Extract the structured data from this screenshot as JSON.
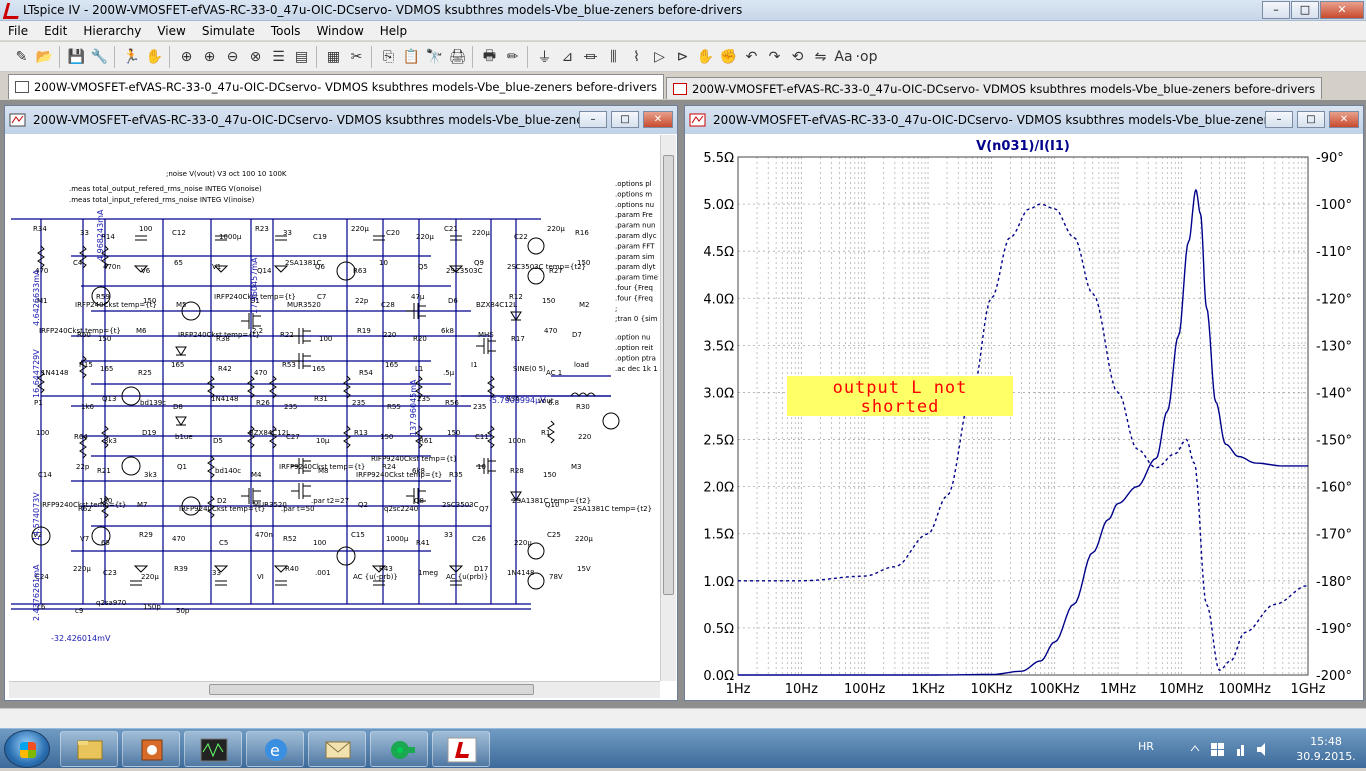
{
  "window": {
    "title": "LTspice IV - 200W-VMOSFET-efVAS-RC-33-0_47u-OIC-DCservo- VDMOS ksubthres models-Vbe_blue-zeners before-drivers",
    "minimize": "–",
    "maximize": "□",
    "close": "✕"
  },
  "menu": [
    "File",
    "Edit",
    "Hierarchy",
    "View",
    "Simulate",
    "Tools",
    "Window",
    "Help"
  ],
  "toolbar_icons": [
    "new-schematic-icon",
    "open-icon",
    "save-icon",
    "control-panel-icon",
    "run-icon",
    "halt-icon",
    "zoom-in-icon",
    "zoom-pan-icon",
    "zoom-out-icon",
    "zoom-cancel-icon",
    "draw-wire-icon",
    "view-netlist-icon",
    "cascade-icon",
    "tile-icon",
    "cut-icon",
    "copy-icon",
    "paste-icon",
    "find-icon",
    "print-setup-icon",
    "print-icon",
    "pencil-icon",
    "ground-icon",
    "label-net-icon",
    "resistor-icon",
    "capacitor-icon",
    "inductor-icon",
    "diode-icon",
    "component-icon",
    "move-icon",
    "drag-icon",
    "undo-icon",
    "redo-icon",
    "rotate-icon",
    "mirror-icon",
    "text-icon",
    "spice-directive-icon"
  ],
  "toolbar_glyphs": [
    "✎",
    "📂",
    "💾",
    "🔧",
    "🏃",
    "✋",
    "⊕",
    "⊕",
    "⊖",
    "⊗",
    "☰",
    "▤",
    "▦",
    "✂",
    "⎘",
    "📋",
    "🔭",
    "🖨",
    "🖶",
    "✏",
    "⏚",
    "⊿",
    "⏛",
    "⫼",
    "⌇",
    "▷",
    "⊳",
    "✋",
    "✊",
    "↶",
    "↷",
    "⟲",
    "⇋",
    "Aa",
    "·op"
  ],
  "tabs": [
    {
      "label": "200W-VMOSFET-efVAS-RC-33-0_47u-OIC-DCservo- VDMOS ksubthres models-Vbe_blue-zeners before-drivers",
      "icon": "schematic-icon"
    },
    {
      "label": "200W-VMOSFET-efVAS-RC-33-0_47u-OIC-DCservo- VDMOS ksubthres models-Vbe_blue-zeners before-drivers",
      "icon": "waveform-icon"
    }
  ],
  "schematic_window": {
    "title": "200W-VMOSFET-efVAS-RC-33-0_47u-OIC-DCservo- VDMOS ksubthres models-Vbe_blue-zeners befo...",
    "directives": [
      ";noise V(vout) V3 oct 100 10 100K",
      ".meas total_output_refered_rms_noise INTEG V(onoise)",
      ".meas total_input_refered_rms_noise INTEG V(inoise)"
    ],
    "right_directives": [
      ".options pl",
      ".options m",
      ".options nu",
      ".param Fre",
      ".param nun",
      ".param dlyc",
      ".param FFT",
      ".param sim",
      ".param dlyt",
      ".param time",
      ".four {Freq",
      ".four {Freq",
      ";",
      ";tran 0 {sim",
      ".option nu",
      ".option reit",
      ".option ptra",
      ".ac dec 1k 1"
    ],
    "components": [
      "R34",
      "33",
      "R14",
      "100",
      "C12",
      "1000µ",
      "R23",
      "33",
      "C19",
      "220µ",
      "C20",
      "220µ",
      "C21",
      "220µ",
      "C22",
      "220µ",
      "R16",
      "470",
      "C4",
      "470n",
      "V6",
      "65",
      "V1",
      "Q14",
      "2SA1381C",
      "Q6",
      "R63",
      "10",
      "Q5",
      "2SC3503C",
      "Q9",
      "2SC3503C temp={t2}",
      "R27",
      "150",
      "M1",
      "IRFP240Ckst temp={t}",
      "R59",
      "150",
      "M5",
      "IRFP240Ckst temp={t}",
      "D1",
      "MUR3520",
      "C7",
      "22p",
      "C28",
      "47µ",
      "D6",
      "BZX84C12L",
      "R12",
      "150",
      "M2",
      "IRFP240Ckst temp={t}",
      "R60",
      "150",
      "M6",
      "IRFP240Ckst temp={t}",
      "R38",
      "2.2",
      "R22",
      "100",
      "R19",
      "220",
      "R20",
      "6k8",
      "MHS",
      "R17",
      "470",
      "D7",
      "1N4148",
      "R15",
      "165",
      "R25",
      "165",
      "R42",
      "470",
      "R53",
      "165",
      "R54",
      "165",
      "L1",
      ".5µ",
      "I1",
      "SINE(0 5)",
      "AC 1",
      "load",
      "P1",
      "1k6",
      "Q13",
      "bd139c",
      "D8",
      "1N4148",
      "R26",
      "235",
      "R31",
      "235",
      "R55",
      "235",
      "R56",
      "235",
      "R36",
      "6.8",
      "R30",
      "100",
      "R64",
      "3k3",
      "D19",
      "b1ue",
      "D5",
      "BZX84C12L",
      "C27",
      "10µ",
      "R13",
      "150",
      "R61",
      "150",
      "C11",
      "100n",
      "R1",
      "220",
      "C14",
      "22p",
      "R21",
      "3k3",
      "Q1",
      "bd140c",
      "M4",
      "IRFP9240Ckst temp={t}",
      "M8",
      "IRFP9240Ckst temp={t}",
      "R24",
      "6k8",
      "R35",
      "10",
      "R28",
      "150",
      "M3",
      "IRFP9240Ckst temp={t}",
      "R62",
      "150",
      "M7",
      "IRFP9240Ckst temp={t}",
      "D2",
      "MUR3520",
      ".par t=50",
      ".par t2=27",
      "Q2",
      "q2sc2240",
      "Q8",
      "2SC3503C",
      "Q7",
      "2SA1381C temp={t2}",
      "Q10",
      "2SA1381C temp={t2}",
      "V2",
      "V7",
      "65",
      "R29",
      "470",
      "C5",
      "470n",
      "R52",
      "100",
      "C15",
      "1000µ",
      "R41",
      "33",
      "C26",
      "220µ",
      "C25",
      "220µ",
      "C24",
      "220µ",
      "C23",
      "220µ",
      "R39",
      "33",
      "VI",
      "R40",
      ".001",
      "AC {u(-prb)}",
      "R43",
      "1meg",
      "AC {u(prb)}",
      "D17",
      "1N4148",
      "78V",
      "15V",
      "c6",
      "c9",
      "q2sa970",
      "150p",
      "50p"
    ],
    "probe_labels": [
      "4.6426633mA",
      "4.968243mA",
      "17.960457mA",
      "16.644729V",
      "137.96045mA",
      "-5.7906994µV",
      "vout",
      "14.574073V",
      "2.4376261mA",
      "-32.426014mV",
      "2.4376251mA",
      "RIFP9240Ckst temp={t}"
    ]
  },
  "waveform_window": {
    "title": "200W-VMOSFET-efVAS-RC-33-0_47u-OIC-DCservo- VDMOS ksubthres models-Vbe_blue-zeners befor...",
    "trace_label": "V(n031)/I(I1)",
    "annotation": [
      "output L not",
      "shorted"
    ]
  },
  "chart_data": {
    "type": "line",
    "title": "V(n031)/I(I1)",
    "xscale": "log",
    "x_ticks": [
      "1Hz",
      "10Hz",
      "100Hz",
      "1KHz",
      "10KHz",
      "100KHz",
      "1MHz",
      "10MHz",
      "100MHz",
      "1GHz"
    ],
    "xlim": [
      1,
      1000000000
    ],
    "y_left_ticks": [
      "0.0Ω",
      "0.5Ω",
      "1.0Ω",
      "1.5Ω",
      "2.0Ω",
      "2.5Ω",
      "3.0Ω",
      "3.5Ω",
      "4.0Ω",
      "4.5Ω",
      "5.0Ω",
      "5.5Ω"
    ],
    "ylim_left": [
      0,
      5.5
    ],
    "y_right_ticks": [
      "-90°",
      "-100°",
      "-110°",
      "-120°",
      "-130°",
      "-140°",
      "-150°",
      "-160°",
      "-170°",
      "-180°",
      "-190°",
      "-200°"
    ],
    "ylim_right": [
      -200,
      -90
    ],
    "grid": true,
    "series": [
      {
        "style": "solid",
        "axis": "left",
        "color": "#00008b",
        "points": [
          [
            1,
            0.0
          ],
          [
            100,
            0.0
          ],
          [
            1000,
            0.0
          ],
          [
            10000,
            0.005
          ],
          [
            30000,
            0.04
          ],
          [
            60000,
            0.15
          ],
          [
            100000,
            0.35
          ],
          [
            200000,
            0.75
          ],
          [
            400000,
            1.3
          ],
          [
            700000,
            1.65
          ],
          [
            1000000,
            1.82
          ],
          [
            2000000,
            2.0
          ],
          [
            4000000,
            2.3
          ],
          [
            6000000,
            2.8
          ],
          [
            9000000,
            3.6
          ],
          [
            13000000,
            4.6
          ],
          [
            17000000,
            5.15
          ],
          [
            20000000,
            4.9
          ],
          [
            25000000,
            3.9
          ],
          [
            35000000,
            2.9
          ],
          [
            50000000,
            2.45
          ],
          [
            80000000,
            2.32
          ],
          [
            150000000,
            2.25
          ],
          [
            400000000,
            2.22
          ],
          [
            1000000000,
            2.22
          ]
        ]
      },
      {
        "style": "dashed",
        "axis": "right",
        "color": "#00008b",
        "points": [
          [
            1,
            -180
          ],
          [
            10,
            -180
          ],
          [
            100,
            -179
          ],
          [
            300,
            -177
          ],
          [
            1000,
            -170
          ],
          [
            2000,
            -162
          ],
          [
            5000,
            -140
          ],
          [
            10000,
            -120
          ],
          [
            20000,
            -107
          ],
          [
            40000,
            -101
          ],
          [
            60000,
            -100
          ],
          [
            100000,
            -101
          ],
          [
            200000,
            -107
          ],
          [
            400000,
            -119
          ],
          [
            1000000,
            -140
          ],
          [
            2000000,
            -152
          ],
          [
            4000000,
            -156
          ],
          [
            8000000,
            -153
          ],
          [
            12000000,
            -150
          ],
          [
            16000000,
            -155
          ],
          [
            25000000,
            -185
          ],
          [
            40000000,
            -199
          ],
          [
            60000000,
            -197
          ],
          [
            100000000,
            -191
          ],
          [
            300000000,
            -185
          ],
          [
            1000000000,
            -181
          ]
        ]
      }
    ]
  },
  "colors": {
    "wire": "#00008b",
    "trace": "#00008b",
    "grid": "#aaaaaa",
    "note_bg": "#ffff66",
    "note_text": "#ff0000",
    "probe_text": "#1a1ab0"
  },
  "status": {
    "text": ""
  },
  "taskbar": {
    "apps": [
      "explorer-icon",
      "task-manager-icon",
      "oscilloscope-icon",
      "internet-explorer-icon",
      "mail-icon",
      "game-icon",
      "ltspice-icon"
    ],
    "language": "HR",
    "time": "15:48",
    "date": "30.9.2015."
  }
}
